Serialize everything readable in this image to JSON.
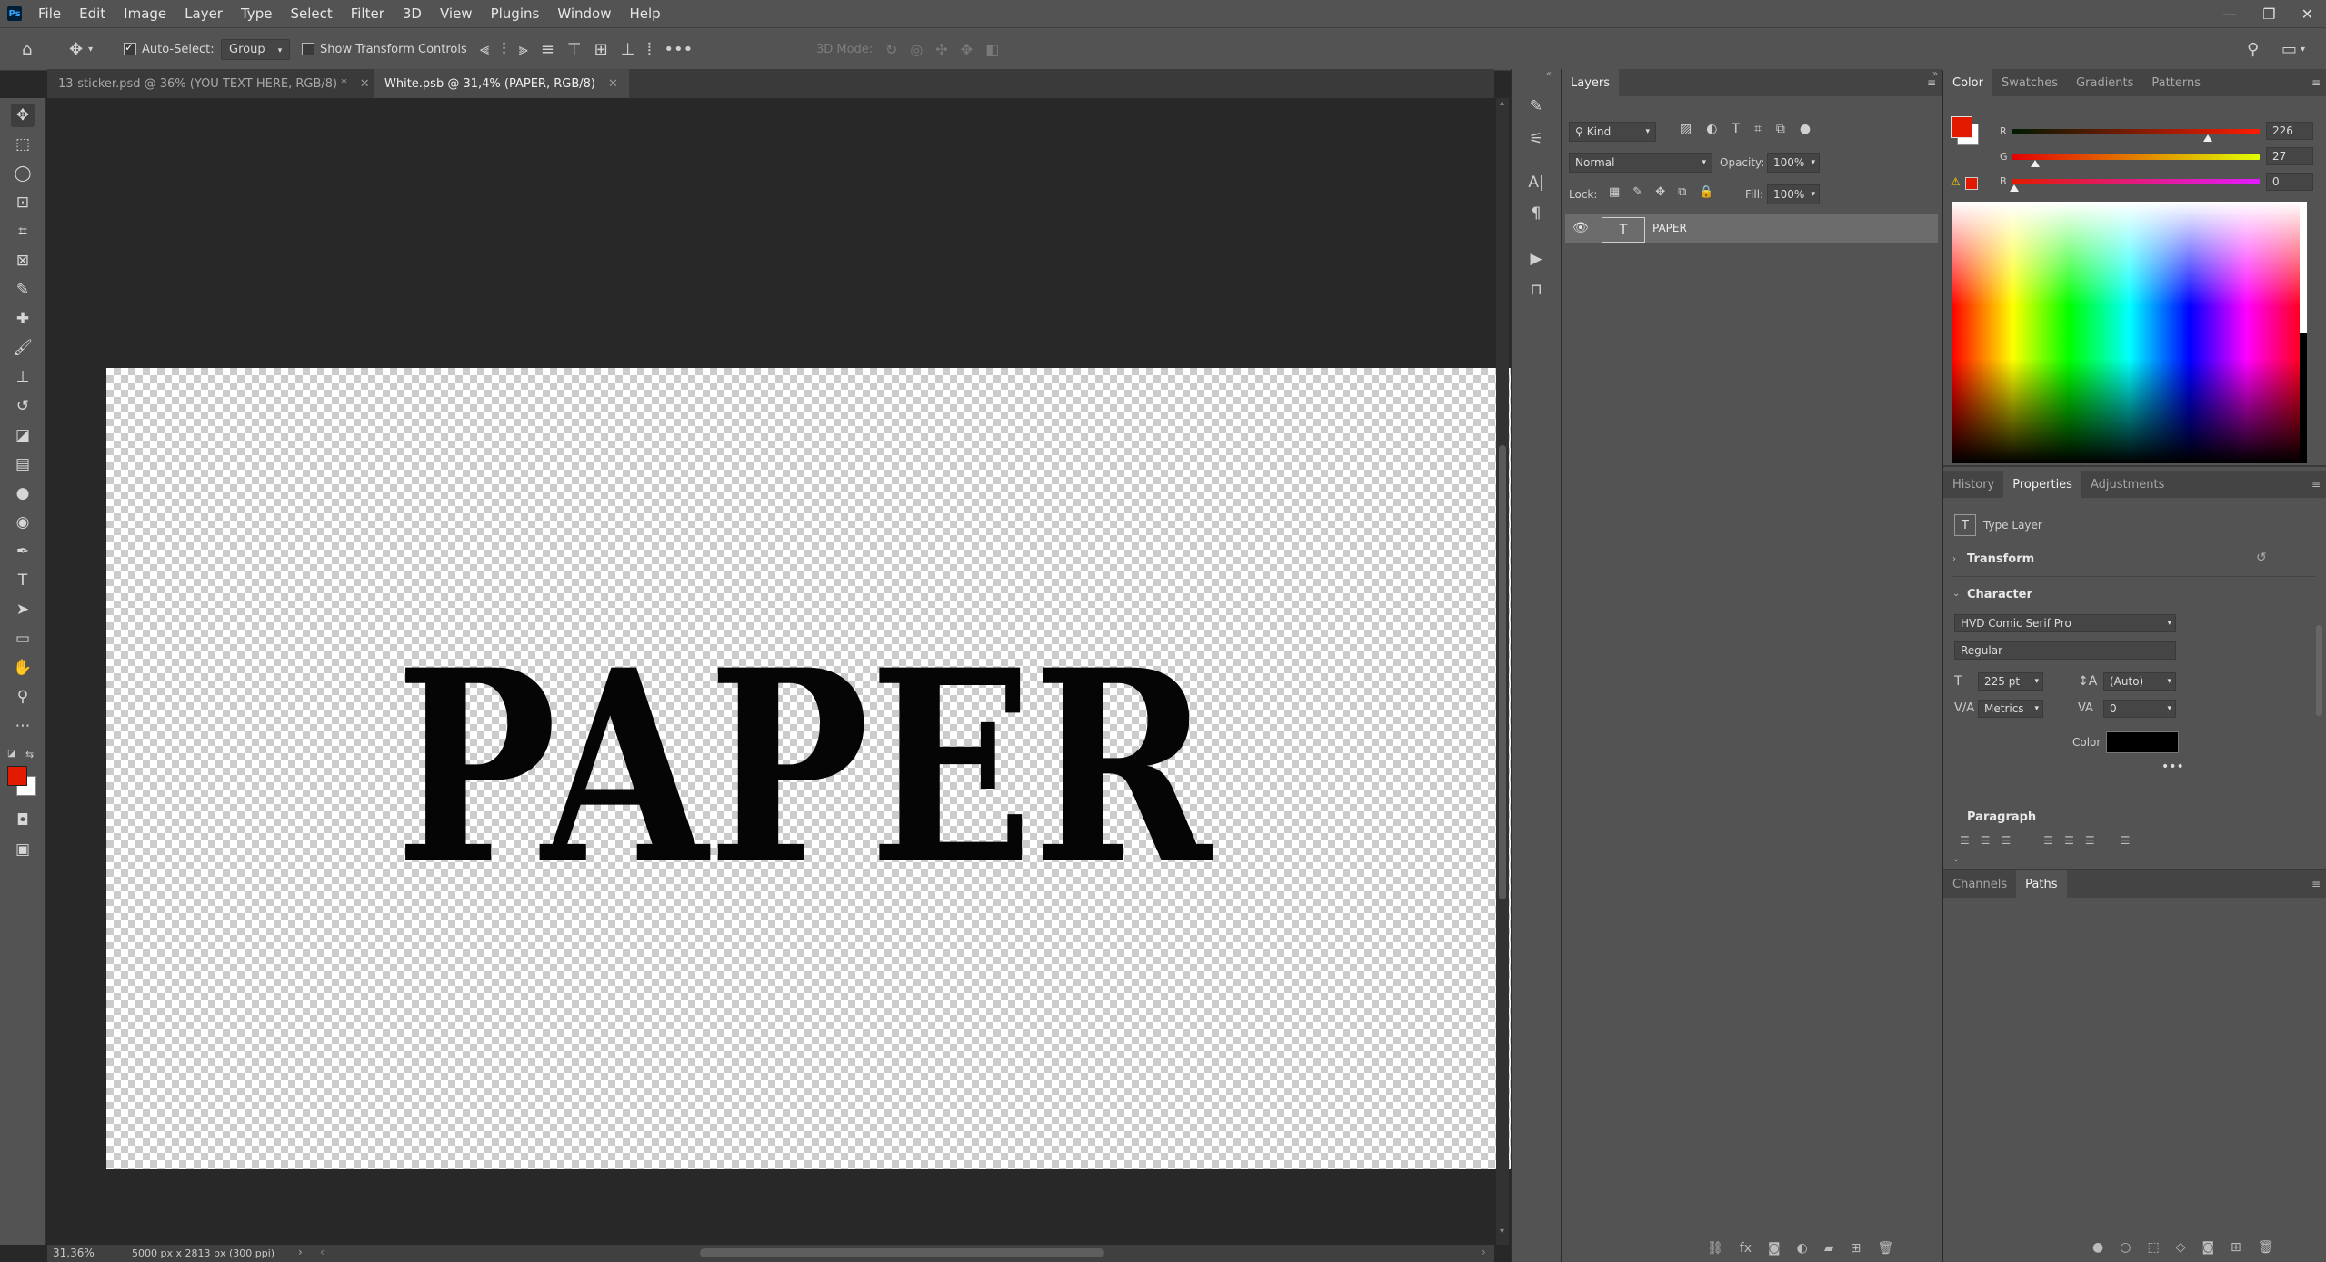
{
  "menubar": {
    "logo": "Ps",
    "items": [
      "File",
      "Edit",
      "Image",
      "Layer",
      "Type",
      "Select",
      "Filter",
      "3D",
      "View",
      "Plugins",
      "Window",
      "Help"
    ]
  },
  "options": {
    "auto_select_label": "Auto-Select:",
    "auto_select_value": "Group",
    "show_transform_label": "Show Transform Controls",
    "mode_3d_label": "3D Mode:"
  },
  "tabs": [
    {
      "label": "13-sticker.psd @ 36% (YOU TEXT HERE, RGB/8) *"
    },
    {
      "label": "White.psb @ 31,4% (PAPER, RGB/8)"
    }
  ],
  "canvas": {
    "text": "PAPER"
  },
  "status": {
    "zoom": "31,36%",
    "doc_info": "5000 px x 2813 px (300 ppi)"
  },
  "layers_panel": {
    "tab": "Layers",
    "filter_kind": "Kind",
    "blend_mode": "Normal",
    "opacity_label": "Opacity:",
    "opacity_value": "100%",
    "lock_label": "Lock:",
    "fill_label": "Fill:",
    "fill_value": "100%",
    "layers": [
      {
        "name": "PAPER",
        "type": "T"
      }
    ]
  },
  "color_panel": {
    "tabs": [
      "Color",
      "Swatches",
      "Gradients",
      "Patterns"
    ],
    "r_label": "R",
    "g_label": "G",
    "b_label": "B",
    "r": "226",
    "g": "27",
    "b": "0",
    "foreground": "#e21b00"
  },
  "properties_panel": {
    "tabs": [
      "History",
      "Properties",
      "Adjustments"
    ],
    "layer_type": "Type Layer",
    "transform_label": "Transform",
    "character_label": "Character",
    "font_family": "HVD Comic Serif Pro",
    "font_style": "Regular",
    "font_size": "225 pt",
    "leading": "(Auto)",
    "kerning": "Metrics",
    "tracking": "0",
    "color_label": "Color",
    "paragraph_label": "Paragraph"
  },
  "paths_panel": {
    "tabs": [
      "Channels",
      "Paths"
    ]
  }
}
